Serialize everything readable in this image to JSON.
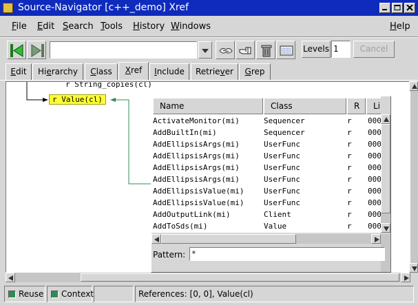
{
  "window": {
    "title": "Source-Navigator [c++_demo] Xref"
  },
  "menubar": {
    "items": [
      "File",
      "Edit",
      "Search",
      "Tools",
      "History",
      "Windows"
    ],
    "help": "Help"
  },
  "toolbar": {
    "combo_value": "",
    "levels_label": "Levels",
    "levels_value": "1",
    "cancel_label": "Cancel"
  },
  "tabs": [
    "Edit",
    "Hierarchy",
    "Class",
    "Xref",
    "Include",
    "Retriever",
    "Grep"
  ],
  "active_tab": "Xref",
  "graph": {
    "partial_node": "r String_copies(cl)",
    "selected_node": "r Value(cl)"
  },
  "xref_list": {
    "columns": [
      "Name",
      "Class",
      "R",
      "Line"
    ],
    "rows": [
      {
        "name": "ActivateMonitor(mi)",
        "class": "Sequencer",
        "r": "r",
        "line": "000"
      },
      {
        "name": "AddBuiltIn(mi)",
        "class": "Sequencer",
        "r": "r",
        "line": "000"
      },
      {
        "name": "AddEllipsisArgs(mi)",
        "class": "UserFunc",
        "r": "r",
        "line": "000"
      },
      {
        "name": "AddEllipsisArgs(mi)",
        "class": "UserFunc",
        "r": "r",
        "line": "000"
      },
      {
        "name": "AddEllipsisArgs(mi)",
        "class": "UserFunc",
        "r": "r",
        "line": "000"
      },
      {
        "name": "AddEllipsisArgs(mi)",
        "class": "UserFunc",
        "r": "r",
        "line": "000"
      },
      {
        "name": "AddEllipsisValue(mi)",
        "class": "UserFunc",
        "r": "r",
        "line": "000"
      },
      {
        "name": "AddEllipsisValue(mi)",
        "class": "UserFunc",
        "r": "r",
        "line": "000"
      },
      {
        "name": "AddOutputLink(mi)",
        "class": "Client",
        "r": "r",
        "line": "000"
      },
      {
        "name": "AddToSds(mi)",
        "class": "Value",
        "r": "r",
        "line": "000"
      }
    ],
    "pattern_label": "Pattern:",
    "pattern_value": "*"
  },
  "status": {
    "reuse_label": "Reuse",
    "context_label": "Context",
    "message": "References: [0, 0], Value(cl)"
  },
  "colors": {
    "titlebar": "#0f2bbd",
    "node_highlight": "#ffff33",
    "edge_green": "#2e8b57",
    "checkbox": "#2e8b57"
  }
}
